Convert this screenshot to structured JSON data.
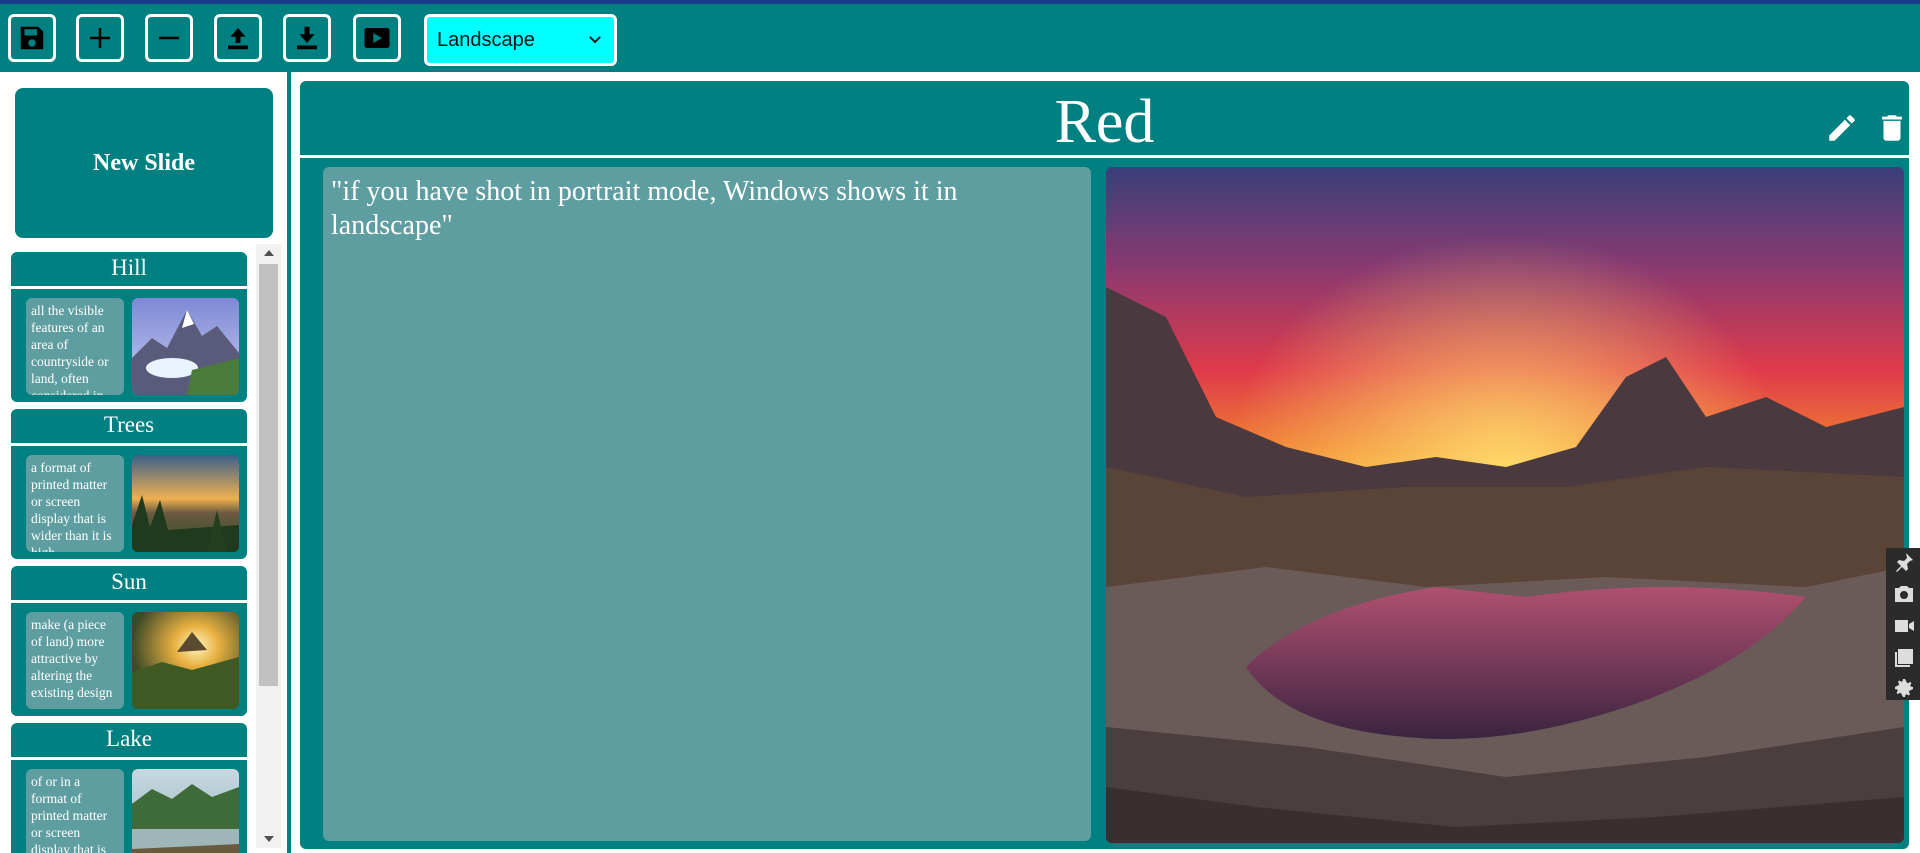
{
  "toolbar": {
    "buttons": [
      {
        "name": "save",
        "icon": "save-icon"
      },
      {
        "name": "add-slide",
        "icon": "plus-icon"
      },
      {
        "name": "remove-slide",
        "icon": "minus-icon"
      },
      {
        "name": "upload",
        "icon": "upload-icon"
      },
      {
        "name": "download",
        "icon": "download-icon"
      },
      {
        "name": "play",
        "icon": "play-icon"
      }
    ],
    "orientation_selected": "Landscape"
  },
  "sidebar": {
    "new_slide_label": "New Slide",
    "slides": [
      {
        "title": "Hill",
        "text": "all the visible features of an area of countryside or land, often considered in terms of their aesthetic appeal"
      },
      {
        "title": "Trees",
        "text": "a format of printed matter or screen display that is wider than it is high"
      },
      {
        "title": "Sun",
        "text": "make (a piece of land) more attractive by altering the existing design"
      },
      {
        "title": "Lake",
        "text": "of or in a format of printed matter or screen display that is wider"
      }
    ]
  },
  "slide": {
    "title": "Red",
    "text": "\"if you have shot in portrait mode, Windows shows it in landscape\"",
    "edit_icon": "pencil-icon",
    "delete_icon": "trash-icon"
  },
  "dock": [
    "pin-icon",
    "camera-icon",
    "video-icon",
    "gallery-icon",
    "settings-icon"
  ],
  "colors": {
    "teal": "#008080",
    "cadet_blue": "#5f9ea0",
    "select_bg": "#00ffff",
    "top_line": "#1c3a8c"
  }
}
